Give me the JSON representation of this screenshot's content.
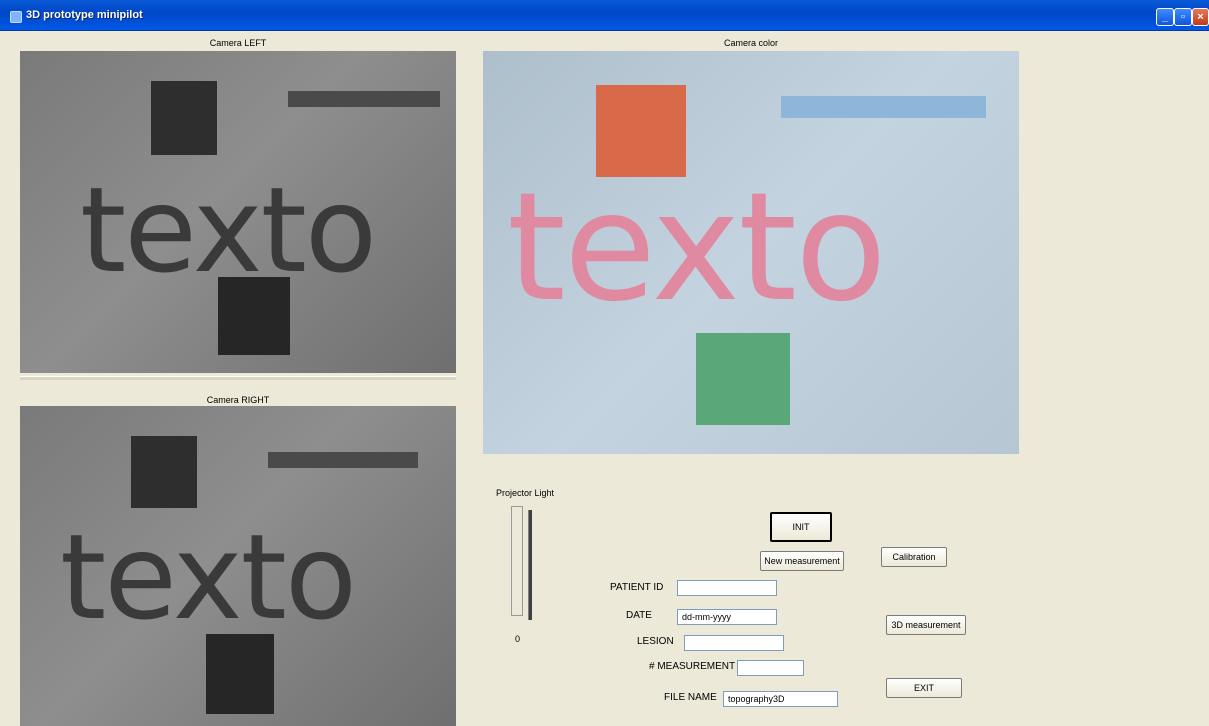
{
  "window": {
    "title": "3D prototype minipilot"
  },
  "cameras": {
    "left_caption": "Camera LEFT",
    "right_caption": "Camera RIGHT",
    "color_caption": "Camera color",
    "image_text": "texto"
  },
  "controls": {
    "projector_label": "Projector Light",
    "projector_value": "0",
    "init_label": "INIT",
    "new_measurement_label": "New measurement",
    "calibration_label": "Calibration",
    "measure3d_label": "3D measurement",
    "exit_label": "EXIT"
  },
  "form": {
    "patient_id_label": "PATIENT ID",
    "patient_id_value": "",
    "date_label": "DATE",
    "date_value": "dd-mm-yyyy",
    "lesion_label": "LESION",
    "lesion_value": "",
    "measurement_label": "# MEASUREMENT",
    "measurement_value": "",
    "filename_label": "FILE NAME",
    "filename_value": "topography3D"
  }
}
